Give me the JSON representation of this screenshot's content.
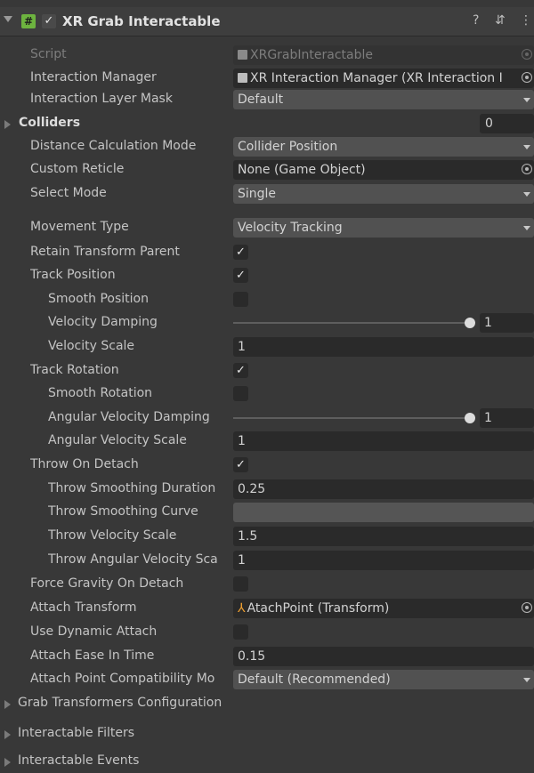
{
  "header": {
    "title": "XR Grab Interactable",
    "script_icon": "#",
    "enabled_check": "✓",
    "help_icon": "?",
    "preset_icon": "⇵",
    "menu_icon": "⋮"
  },
  "check_glyph": "✓",
  "rows": {
    "script": {
      "label": "Script",
      "value": "XRGrabInteractable"
    },
    "interaction_manager": {
      "label": "Interaction Manager",
      "value": "XR Interaction Manager (XR Interaction I"
    },
    "interaction_layer_mask": {
      "label": "Interaction Layer Mask",
      "value": "Default"
    },
    "colliders": {
      "label": "Colliders",
      "value": "0"
    },
    "distance_calc_mode": {
      "label": "Distance Calculation Mode",
      "value": "Collider Position"
    },
    "custom_reticle": {
      "label": "Custom Reticle",
      "value": "None (Game Object)"
    },
    "select_mode": {
      "label": "Select Mode",
      "value": "Single"
    },
    "movement_type": {
      "label": "Movement Type",
      "value": "Velocity Tracking"
    },
    "retain_transform_parent": {
      "label": "Retain Transform Parent",
      "checked": true
    },
    "track_position": {
      "label": "Track Position",
      "checked": true
    },
    "smooth_position": {
      "label": "Smooth Position",
      "checked": false
    },
    "velocity_damping": {
      "label": "Velocity Damping",
      "value": "1",
      "fraction": 1.0
    },
    "velocity_scale": {
      "label": "Velocity Scale",
      "value": "1"
    },
    "track_rotation": {
      "label": "Track Rotation",
      "checked": true
    },
    "smooth_rotation": {
      "label": "Smooth Rotation",
      "checked": false
    },
    "angular_velocity_damping": {
      "label": "Angular Velocity Damping",
      "value": "1",
      "fraction": 1.0
    },
    "angular_velocity_scale": {
      "label": "Angular Velocity Scale",
      "value": "1"
    },
    "throw_on_detach": {
      "label": "Throw On Detach",
      "checked": true
    },
    "throw_smoothing_duration": {
      "label": "Throw Smoothing Duration",
      "value": "0.25"
    },
    "throw_smoothing_curve": {
      "label": "Throw Smoothing Curve"
    },
    "throw_velocity_scale": {
      "label": "Throw Velocity Scale",
      "value": "1.5"
    },
    "throw_angular_velocity_scale": {
      "label": "Throw Angular Velocity Sca",
      "value": "1"
    },
    "force_gravity_on_detach": {
      "label": "Force Gravity On Detach",
      "checked": false
    },
    "attach_transform": {
      "label": "Attach Transform",
      "value": "AtachPoint (Transform)"
    },
    "use_dynamic_attach": {
      "label": "Use Dynamic Attach",
      "checked": false
    },
    "attach_ease_in_time": {
      "label": "Attach Ease In Time",
      "value": "0.15"
    },
    "attach_point_compat_mode": {
      "label": "Attach Point Compatibility Mo",
      "value": "Default (Recommended)"
    }
  },
  "foldouts": {
    "grab_transformers": "Grab Transformers Configuration",
    "interactable_filters": "Interactable Filters",
    "interactable_events": "Interactable Events"
  }
}
